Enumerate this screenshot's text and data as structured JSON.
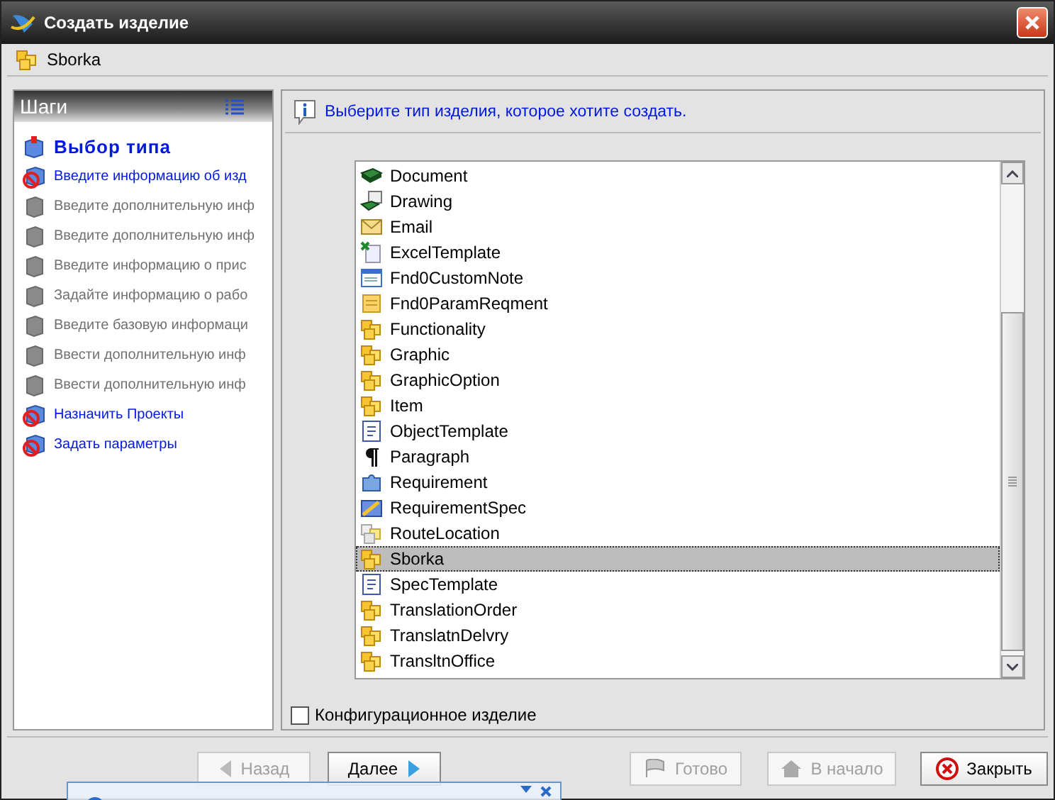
{
  "window": {
    "title": "Создать изделие"
  },
  "context": {
    "label": "Sborka"
  },
  "steps_panel": {
    "title": "Шаги",
    "items": [
      {
        "label": "Выбор типа",
        "kind": "current"
      },
      {
        "label": "Введите информацию об изд",
        "kind": "active"
      },
      {
        "label": "Введите дополнительную инф",
        "kind": "disabled"
      },
      {
        "label": "Введите дополнительную инф",
        "kind": "disabled"
      },
      {
        "label": "Введите информацию о прис",
        "kind": "disabled"
      },
      {
        "label": "Задайте информацию о рабо",
        "kind": "disabled"
      },
      {
        "label": "Введите базовую информаци",
        "kind": "disabled"
      },
      {
        "label": "Ввести дополнительную инф",
        "kind": "disabled"
      },
      {
        "label": "Ввести дополнительную инф",
        "kind": "disabled"
      },
      {
        "label": "Назначить Проекты",
        "kind": "active"
      },
      {
        "label": "Задать параметры",
        "kind": "active"
      }
    ]
  },
  "hint": "Выберите тип изделия, которое хотите создать.",
  "types": [
    {
      "label": "Document",
      "kind": "book",
      "selected": false
    },
    {
      "label": "Drawing",
      "kind": "drawing",
      "selected": false
    },
    {
      "label": "Email",
      "kind": "mail",
      "selected": false
    },
    {
      "label": "ExcelTemplate",
      "kind": "excel",
      "selected": false
    },
    {
      "label": "Fnd0CustomNote",
      "kind": "note",
      "selected": false
    },
    {
      "label": "Fnd0ParamReqment",
      "kind": "param",
      "selected": false
    },
    {
      "label": "Functionality",
      "kind": "cubes",
      "selected": false
    },
    {
      "label": "Graphic",
      "kind": "cubes",
      "selected": false
    },
    {
      "label": "GraphicOption",
      "kind": "cubes",
      "selected": false
    },
    {
      "label": "Item",
      "kind": "cubes",
      "selected": false
    },
    {
      "label": "ObjectTemplate",
      "kind": "template",
      "selected": false
    },
    {
      "label": "Paragraph",
      "kind": "pilcrow",
      "selected": false
    },
    {
      "label": "Requirement",
      "kind": "puzzle",
      "selected": false
    },
    {
      "label": "RequirementSpec",
      "kind": "spec",
      "selected": false
    },
    {
      "label": "RouteLocation",
      "kind": "pale",
      "selected": false
    },
    {
      "label": "Sborka",
      "kind": "cubes",
      "selected": true
    },
    {
      "label": "SpecTemplate",
      "kind": "template",
      "selected": false
    },
    {
      "label": "TranslationOrder",
      "kind": "cubes",
      "selected": false
    },
    {
      "label": "TranslatnDelvry",
      "kind": "cubes",
      "selected": false
    },
    {
      "label": "TransltnOffice",
      "kind": "cubes",
      "selected": false
    }
  ],
  "configurable": {
    "label": "Конфигурационное изделие",
    "checked": false
  },
  "buttons": [
    {
      "label": "Назад",
      "kind": "back",
      "disabled": true
    },
    {
      "label": "Далее",
      "kind": "next",
      "disabled": false
    },
    {
      "label": "Готово",
      "kind": "finish",
      "disabled": true
    },
    {
      "label": "В начало",
      "kind": "home",
      "disabled": true
    },
    {
      "label": "Закрыть",
      "kind": "close",
      "disabled": false
    }
  ]
}
